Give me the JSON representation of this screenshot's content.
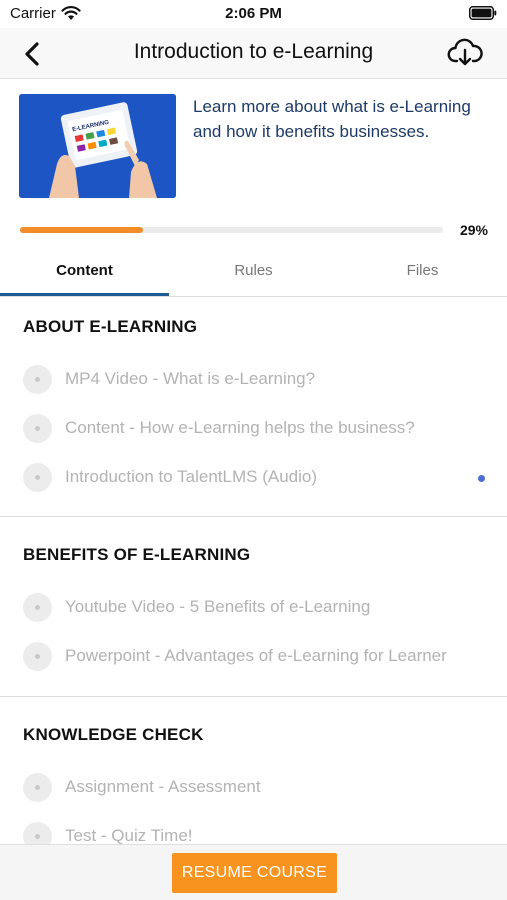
{
  "status_bar": {
    "carrier": "Carrier",
    "time": "2:06 PM",
    "icons": [
      "wifi-icon",
      "battery-icon"
    ]
  },
  "nav": {
    "title": "Introduction to e-Learning",
    "back_icon": "chevron-left-icon",
    "download_icon": "cloud-download-icon"
  },
  "course": {
    "description": "Learn more about what is e-Learning and how it benefits businesses.",
    "thumbnail_text": "E-LEARNING",
    "progress_percent": 29,
    "progress_label": "29%",
    "progress_color": "#f28c28"
  },
  "tabs": [
    {
      "label": "Content",
      "active": true
    },
    {
      "label": "Rules",
      "active": false
    },
    {
      "label": "Files",
      "active": false
    }
  ],
  "sections": [
    {
      "title": "ABOUT E-LEARNING",
      "units": [
        {
          "label": "MP4 Video - What is e-Learning?"
        },
        {
          "label": "Content - How e-Learning helps the business?"
        },
        {
          "label": "Introduction to TalentLMS (Audio)",
          "current": true
        }
      ]
    },
    {
      "title": "BENEFITS OF E-LEARNING",
      "units": [
        {
          "label": "Youtube Video - 5 Benefits of e-Learning"
        },
        {
          "label": "Powerpoint - Advantages of e-Learning for Learner"
        }
      ]
    },
    {
      "title": "KNOWLEDGE CHECK",
      "units": [
        {
          "label": "Assignment - Assessment"
        },
        {
          "label": "Test - Quiz Time!"
        }
      ]
    }
  ],
  "footer": {
    "resume_label": "RESUME COURSE",
    "accent": "#f7931e"
  }
}
